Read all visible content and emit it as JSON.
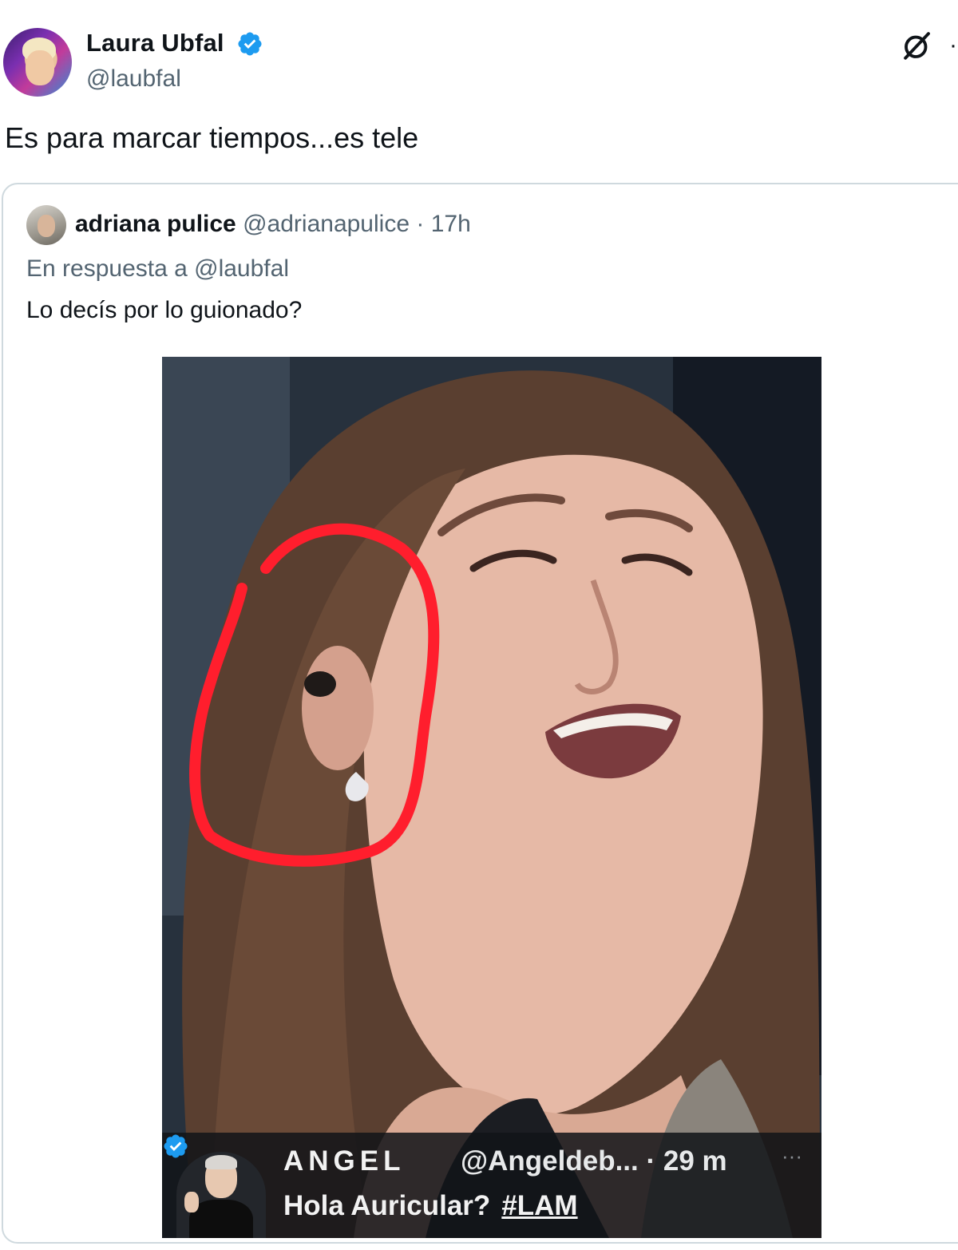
{
  "author": {
    "display_name": "Laura Ubfal",
    "handle": "@laubfal",
    "verified": true
  },
  "tweet": {
    "text": "Es para marcar tiempos...es tele"
  },
  "icons": {
    "verified": "verified-badge-icon",
    "grok": "grok-icon",
    "more": "more-options-icon"
  },
  "colors": {
    "verified_blue": "#1d9bf0",
    "secondary_text": "#536471",
    "border": "#cfd9de",
    "circle_annotation": "#ff1e2d"
  },
  "quote": {
    "display_name": "adriana pulice",
    "handle": "@adrianapulice",
    "separator": "·",
    "time": "17h",
    "reply_to": "En respuesta a @laubfal",
    "text": "Lo decís por lo guionado?",
    "image": {
      "description_icon": "photo-icon",
      "embedded_post": {
        "display_name": "ANGEL",
        "handle_time": "@Angeldeb... · 29 m",
        "text": "Hola Auricular?",
        "hashtag": "#LAM",
        "more": "···"
      }
    }
  }
}
